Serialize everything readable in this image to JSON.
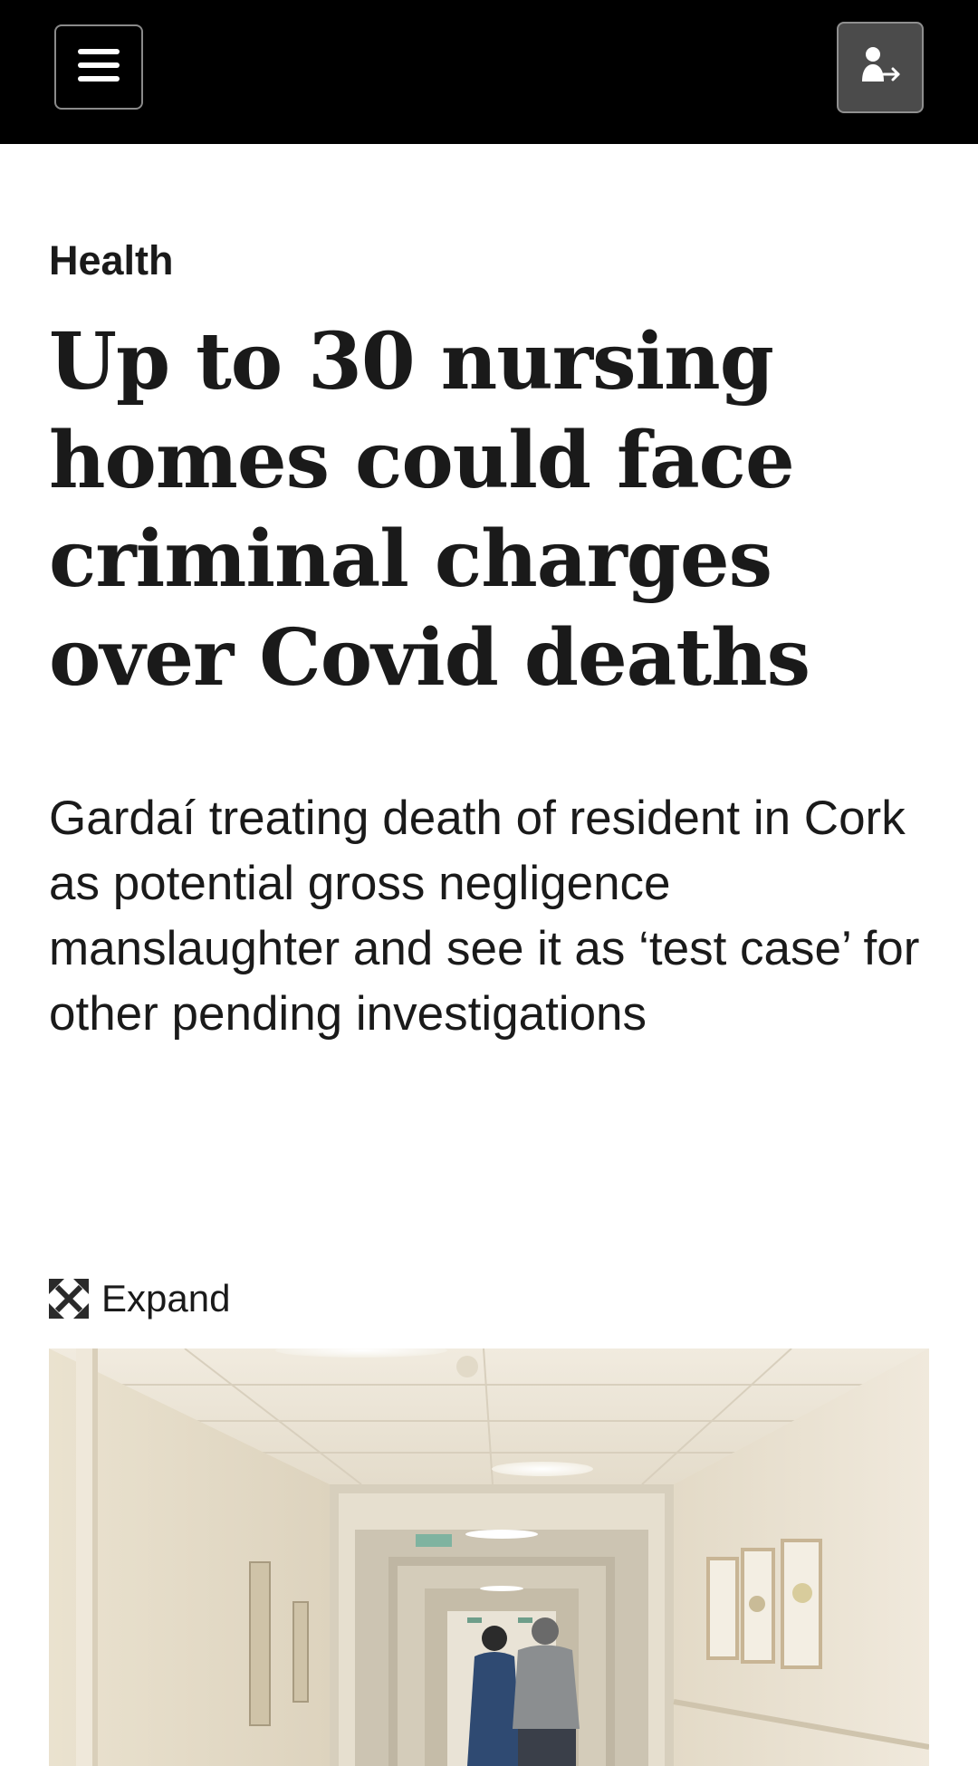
{
  "header": {
    "menu_icon": "hamburger-menu-icon",
    "account_icon": "sign-in-user-icon",
    "background_color": "#000000"
  },
  "article": {
    "section": "Health",
    "headline": "Up to 30 nursing homes could face criminal charges over Covid deaths",
    "standfirst": "Gardaí treating death of resident in Cork as potential gross negligence manslaughter and see it as ‘test case’ for other pending investigations"
  },
  "media": {
    "expand_label": "Expand",
    "expand_icon": "expand-arrows-icon",
    "image_subject": "nursing-home-corridor-photo"
  }
}
